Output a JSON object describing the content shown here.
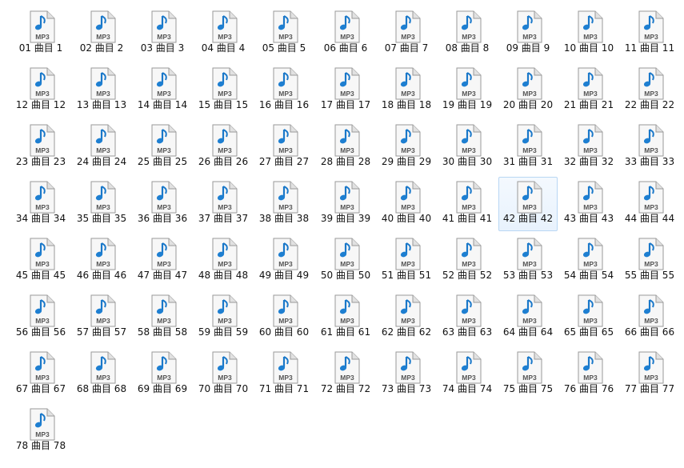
{
  "file_icon": {
    "name": "mp3-file-icon",
    "badge": "MP3",
    "accent": "#1e7fd1",
    "glyph": "♪"
  },
  "hovered_index": 41,
  "files": [
    {
      "label": "01 曲目 1"
    },
    {
      "label": "02 曲目 2"
    },
    {
      "label": "03 曲目 3"
    },
    {
      "label": "04 曲目 4"
    },
    {
      "label": "05 曲目 5"
    },
    {
      "label": "06 曲目 6"
    },
    {
      "label": "07 曲目 7"
    },
    {
      "label": "08 曲目 8"
    },
    {
      "label": "09 曲目 9"
    },
    {
      "label": "10 曲目 10"
    },
    {
      "label": "11 曲目 11"
    },
    {
      "label": "12 曲目 12"
    },
    {
      "label": "13 曲目 13"
    },
    {
      "label": "14 曲目 14"
    },
    {
      "label": "15 曲目 15"
    },
    {
      "label": "16 曲目 16"
    },
    {
      "label": "17 曲目 17"
    },
    {
      "label": "18 曲目 18"
    },
    {
      "label": "19 曲目 19"
    },
    {
      "label": "20 曲目 20"
    },
    {
      "label": "21 曲目 21"
    },
    {
      "label": "22 曲目 22"
    },
    {
      "label": "23 曲目 23"
    },
    {
      "label": "24 曲目 24"
    },
    {
      "label": "25 曲目 25"
    },
    {
      "label": "26 曲目 26"
    },
    {
      "label": "27 曲目 27"
    },
    {
      "label": "28 曲目 28"
    },
    {
      "label": "29 曲目 29"
    },
    {
      "label": "30 曲目 30"
    },
    {
      "label": "31 曲目 31"
    },
    {
      "label": "32 曲目 32"
    },
    {
      "label": "33 曲目 33"
    },
    {
      "label": "34 曲目 34"
    },
    {
      "label": "35 曲目 35"
    },
    {
      "label": "36 曲目 36"
    },
    {
      "label": "37 曲目 37"
    },
    {
      "label": "38 曲目 38"
    },
    {
      "label": "39 曲目 39"
    },
    {
      "label": "40 曲目 40"
    },
    {
      "label": "41 曲目 41"
    },
    {
      "label": "42 曲目 42"
    },
    {
      "label": "43 曲目 43"
    },
    {
      "label": "44 曲目 44"
    },
    {
      "label": "45 曲目 45"
    },
    {
      "label": "46 曲目 46"
    },
    {
      "label": "47 曲目 47"
    },
    {
      "label": "48 曲目 48"
    },
    {
      "label": "49 曲目 49"
    },
    {
      "label": "50 曲目 50"
    },
    {
      "label": "51 曲目 51"
    },
    {
      "label": "52 曲目 52"
    },
    {
      "label": "53 曲目 53"
    },
    {
      "label": "54 曲目 54"
    },
    {
      "label": "55 曲目 55"
    },
    {
      "label": "56 曲目 56"
    },
    {
      "label": "57 曲目 57"
    },
    {
      "label": "58 曲目 58"
    },
    {
      "label": "59 曲目 59"
    },
    {
      "label": "60 曲目 60"
    },
    {
      "label": "61 曲目 61"
    },
    {
      "label": "62 曲目 62"
    },
    {
      "label": "63 曲目 63"
    },
    {
      "label": "64 曲目 64"
    },
    {
      "label": "65 曲目 65"
    },
    {
      "label": "66 曲目 66"
    },
    {
      "label": "67 曲目 67"
    },
    {
      "label": "68 曲目 68"
    },
    {
      "label": "69 曲目 69"
    },
    {
      "label": "70 曲目 70"
    },
    {
      "label": "71 曲目 71"
    },
    {
      "label": "72 曲目 72"
    },
    {
      "label": "73 曲目 73"
    },
    {
      "label": "74 曲目 74"
    },
    {
      "label": "75 曲目 75"
    },
    {
      "label": "76 曲目 76"
    },
    {
      "label": "77 曲目 77"
    },
    {
      "label": "78 曲目 78"
    }
  ]
}
